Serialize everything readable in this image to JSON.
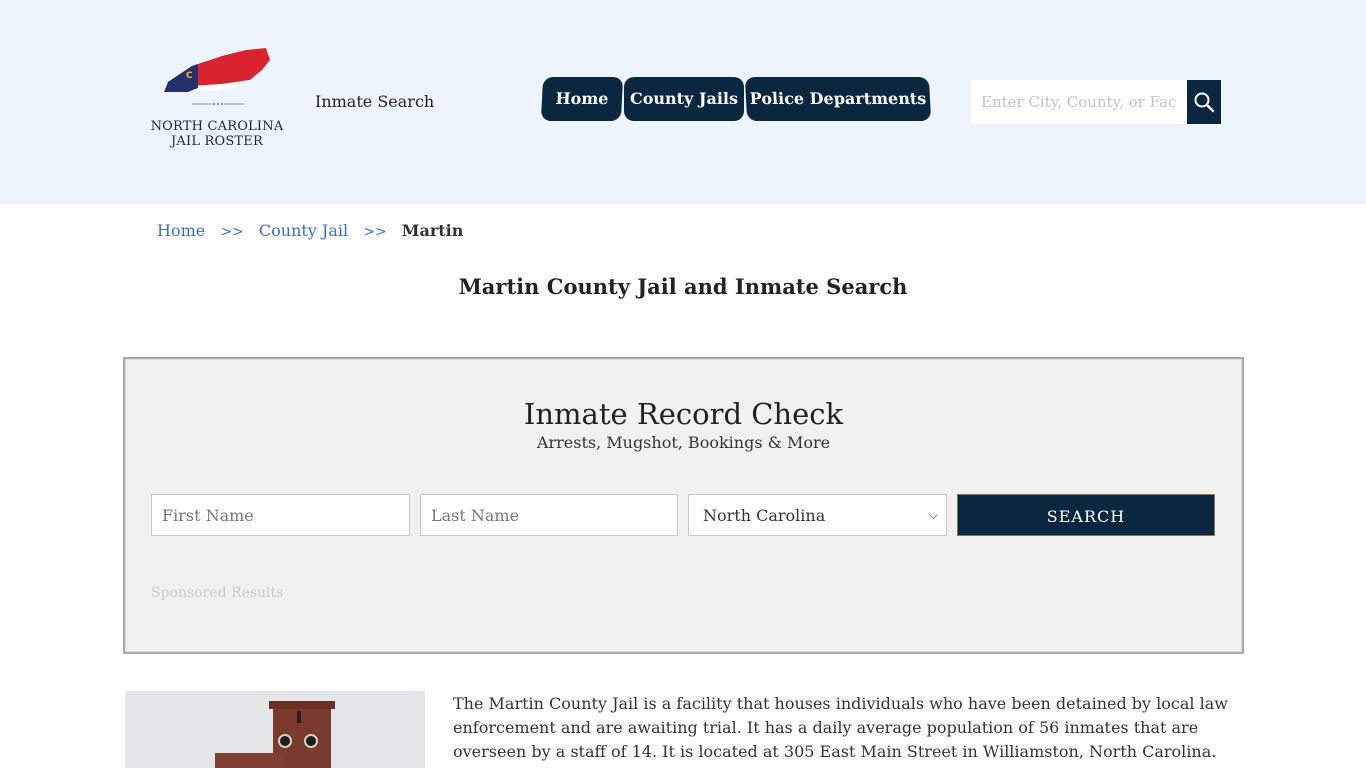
{
  "header": {
    "logo_text_line1": "NORTH CAROLINA",
    "logo_text_line2": "JAIL ROSTER",
    "tagline": "Inmate Search",
    "nav": [
      {
        "label": "Home"
      },
      {
        "label": "County Jails"
      },
      {
        "label": "Police Departments"
      }
    ],
    "search": {
      "placeholder": "Enter City, County, or Facility"
    },
    "colors": {
      "header_bg": "#edf4fd",
      "nav_bg": "#0b2740"
    }
  },
  "breadcrumb": {
    "items": [
      "Home",
      "County Jail"
    ],
    "separator": ">>",
    "current": "Martin"
  },
  "page_title": "Martin County Jail and Inmate Search",
  "record_check": {
    "title": "Inmate Record Check",
    "subtitle": "Arrests, Mugshot, Bookings & More",
    "first_name_placeholder": "First Name",
    "last_name_placeholder": "Last Name",
    "state_selected": "North Carolina",
    "submit_label": "SEARCH",
    "sponsored": "Sponsored Results"
  },
  "content": {
    "paragraph": "The Martin County Jail is a facility that houses individuals who have been detained by local law enforcement and are awaiting trial. It has a daily average population of 56 inmates that are overseen by a staff of 14. It is located at 305 East Main Street in Williamston, North Carolina."
  }
}
